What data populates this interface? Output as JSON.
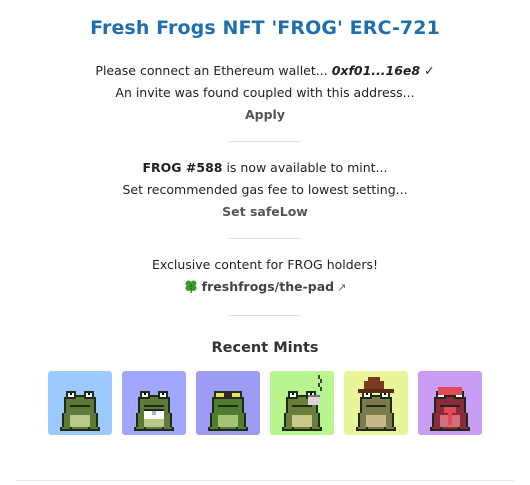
{
  "title": "Fresh Frogs NFT 'FROG' ERC-721",
  "wallet": {
    "prompt": "Please connect an Ethereum wallet...",
    "address": "0xf01...16e8",
    "check": "✓",
    "invite": "An invite was found coupled with this address...",
    "apply_label": "Apply"
  },
  "mint": {
    "token": "FROG #588",
    "status": " is now available to mint...",
    "gas_note": "Set recommended gas fee to lowest setting...",
    "safelow_label": "Set safeLow"
  },
  "exclusive": {
    "text": "Exclusive content for FROG holders!",
    "link_label": "freshfrogs/the-pad",
    "link_icon": "clover-icon",
    "ext_glyph": "↗"
  },
  "recent": {
    "title": "Recent Mints",
    "tiles": [
      {
        "bg": "#9ccaff",
        "body": "#5d7a3a",
        "belly": "#b8c98a",
        "accessory": "none"
      },
      {
        "bg": "#a3a6ff",
        "body": "#5d7a3a",
        "belly": "#b8c98a",
        "accessory": "bib"
      },
      {
        "bg": "#9c9cf5",
        "body": "#4f7d2f",
        "belly": "#a6c276",
        "accessory": "goggles"
      },
      {
        "bg": "#b8f58f",
        "body": "#6b7d3a",
        "belly": "#c9c98a",
        "accessory": "steam"
      },
      {
        "bg": "#eaf59a",
        "body": "#7a7a4a",
        "belly": "#c9b88a",
        "accessory": "hat"
      },
      {
        "bg": "#c99cf5",
        "body": "#8a2a3a",
        "belly": "#d0707a",
        "accessory": "tongue"
      }
    ]
  }
}
